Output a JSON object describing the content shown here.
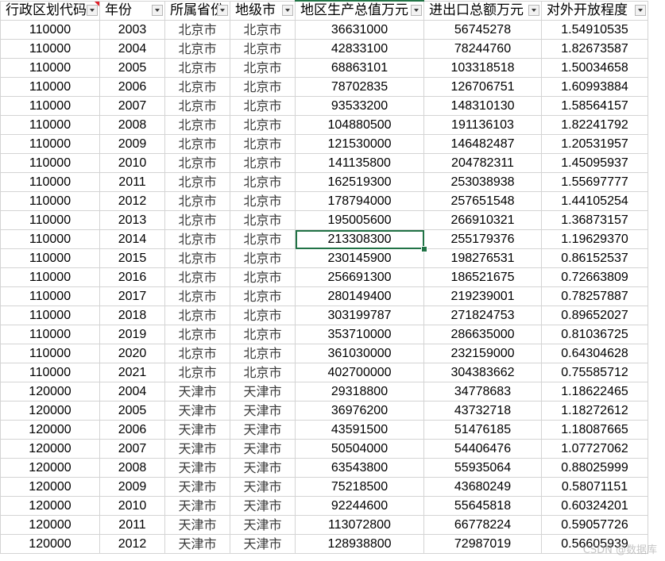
{
  "columns": [
    {
      "label": "行政区划代码",
      "has_comment": true
    },
    {
      "label": "年份",
      "has_comment": false
    },
    {
      "label": "所属省份",
      "has_comment": false
    },
    {
      "label": "地级市",
      "has_comment": false
    },
    {
      "label": "地区生产总值万元",
      "has_comment": false,
      "active": true
    },
    {
      "label": "进出口总额万元",
      "has_comment": false
    },
    {
      "label": "对外开放程度",
      "has_comment": false
    }
  ],
  "rows": [
    [
      "110000",
      "2003",
      "北京市",
      "北京市",
      "36631000",
      "56745278",
      "1.54910535"
    ],
    [
      "110000",
      "2004",
      "北京市",
      "北京市",
      "42833100",
      "78244760",
      "1.82673587"
    ],
    [
      "110000",
      "2005",
      "北京市",
      "北京市",
      "68863101",
      "103318518",
      "1.50034658"
    ],
    [
      "110000",
      "2006",
      "北京市",
      "北京市",
      "78702835",
      "126706751",
      "1.60993884"
    ],
    [
      "110000",
      "2007",
      "北京市",
      "北京市",
      "93533200",
      "148310130",
      "1.58564157"
    ],
    [
      "110000",
      "2008",
      "北京市",
      "北京市",
      "104880500",
      "191136103",
      "1.82241792"
    ],
    [
      "110000",
      "2009",
      "北京市",
      "北京市",
      "121530000",
      "146482487",
      "1.20531957"
    ],
    [
      "110000",
      "2010",
      "北京市",
      "北京市",
      "141135800",
      "204782311",
      "1.45095937"
    ],
    [
      "110000",
      "2011",
      "北京市",
      "北京市",
      "162519300",
      "253038938",
      "1.55697777"
    ],
    [
      "110000",
      "2012",
      "北京市",
      "北京市",
      "178794000",
      "257651548",
      "1.44105254"
    ],
    [
      "110000",
      "2013",
      "北京市",
      "北京市",
      "195005600",
      "266910321",
      "1.36873157"
    ],
    [
      "110000",
      "2014",
      "北京市",
      "北京市",
      "213308300",
      "255179376",
      "1.19629370"
    ],
    [
      "110000",
      "2015",
      "北京市",
      "北京市",
      "230145900",
      "198276531",
      "0.86152537"
    ],
    [
      "110000",
      "2016",
      "北京市",
      "北京市",
      "256691300",
      "186521675",
      "0.72663809"
    ],
    [
      "110000",
      "2017",
      "北京市",
      "北京市",
      "280149400",
      "219239001",
      "0.78257887"
    ],
    [
      "110000",
      "2018",
      "北京市",
      "北京市",
      "303199787",
      "271824753",
      "0.89652027"
    ],
    [
      "110000",
      "2019",
      "北京市",
      "北京市",
      "353710000",
      "286635000",
      "0.81036725"
    ],
    [
      "110000",
      "2020",
      "北京市",
      "北京市",
      "361030000",
      "232159000",
      "0.64304628"
    ],
    [
      "110000",
      "2021",
      "北京市",
      "北京市",
      "402700000",
      "304383662",
      "0.75585712"
    ],
    [
      "120000",
      "2004",
      "天津市",
      "天津市",
      "29318800",
      "34778683",
      "1.18622465"
    ],
    [
      "120000",
      "2005",
      "天津市",
      "天津市",
      "36976200",
      "43732718",
      "1.18272612"
    ],
    [
      "120000",
      "2006",
      "天津市",
      "天津市",
      "43591500",
      "51476185",
      "1.18087665"
    ],
    [
      "120000",
      "2007",
      "天津市",
      "天津市",
      "50504000",
      "54406476",
      "1.07727062"
    ],
    [
      "120000",
      "2008",
      "天津市",
      "天津市",
      "63543800",
      "55935064",
      "0.88025999"
    ],
    [
      "120000",
      "2009",
      "天津市",
      "天津市",
      "75218500",
      "43680249",
      "0.58071151"
    ],
    [
      "120000",
      "2010",
      "天津市",
      "天津市",
      "92244600",
      "55645818",
      "0.60324201"
    ],
    [
      "120000",
      "2011",
      "天津市",
      "天津市",
      "113072800",
      "66778224",
      "0.59057726"
    ],
    [
      "120000",
      "2012",
      "天津市",
      "天津市",
      "128938800",
      "72987019",
      "0.56605939"
    ]
  ],
  "selected_cell": {
    "row": 11,
    "col": 4
  },
  "watermark": "CSDN @数据库",
  "colors": {
    "selection": "#217346",
    "comment_marker": "#e0202a",
    "gridline": "#d4d4d4"
  }
}
